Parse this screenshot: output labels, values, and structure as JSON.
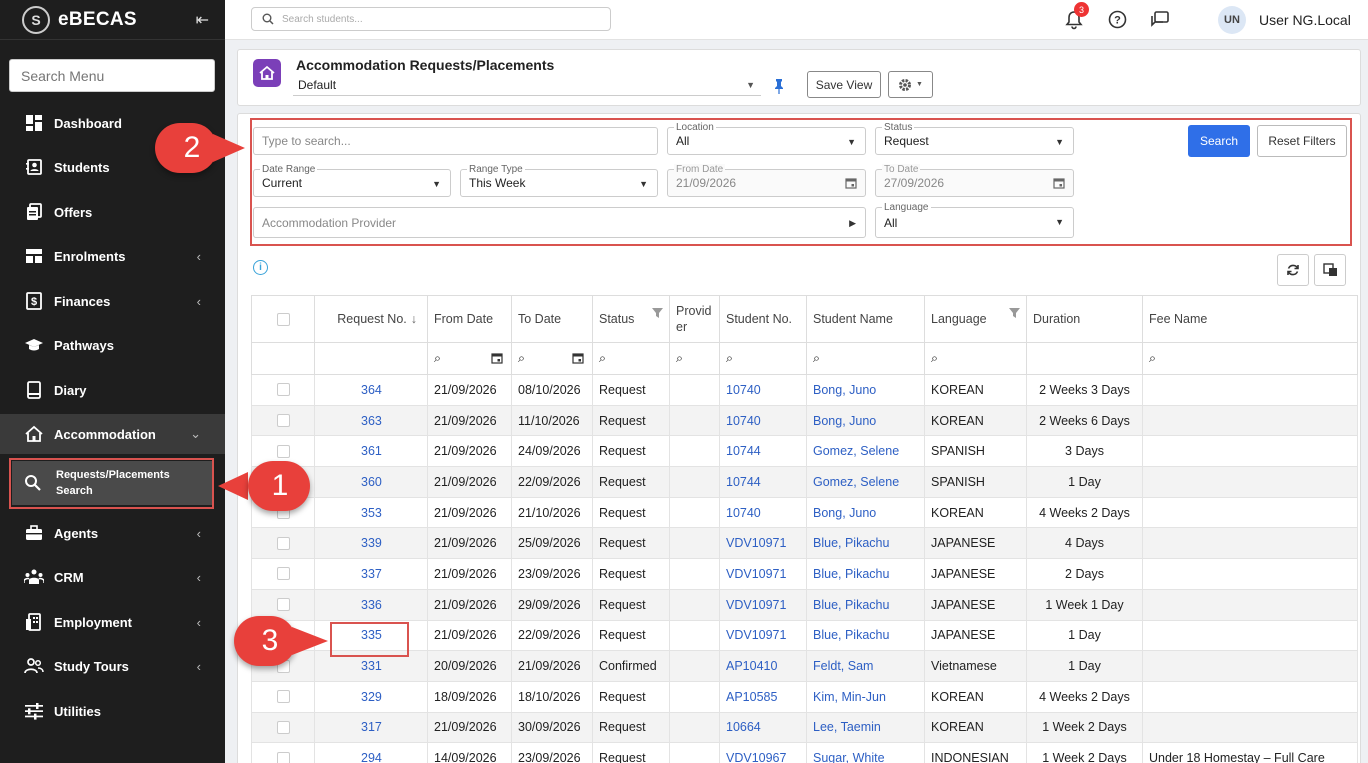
{
  "app": {
    "name": "eBECAS"
  },
  "sidebar": {
    "search_placeholder": "Search Menu",
    "items": [
      {
        "label": "Dashboard",
        "icon": "dashboard-icon",
        "chevron": ""
      },
      {
        "label": "Students",
        "icon": "students-icon",
        "chevron": ""
      },
      {
        "label": "Offers",
        "icon": "offers-icon",
        "chevron": ""
      },
      {
        "label": "Enrolments",
        "icon": "enrolments-icon",
        "chevron": "‹"
      },
      {
        "label": "Finances",
        "icon": "finances-icon",
        "chevron": "‹"
      },
      {
        "label": "Pathways",
        "icon": "pathways-icon",
        "chevron": ""
      },
      {
        "label": "Diary",
        "icon": "diary-icon",
        "chevron": ""
      },
      {
        "label": "Accommodation",
        "icon": "home-icon",
        "chevron": "⌄"
      },
      {
        "label": "Agents",
        "icon": "agents-icon",
        "chevron": "‹"
      },
      {
        "label": "CRM",
        "icon": "crm-icon",
        "chevron": "‹"
      },
      {
        "label": "Employment",
        "icon": "employment-icon",
        "chevron": "‹"
      },
      {
        "label": "Study Tours",
        "icon": "study-tours-icon",
        "chevron": "‹"
      },
      {
        "label": "Utilities",
        "icon": "utilities-icon",
        "chevron": ""
      }
    ],
    "subitem": {
      "label": "Requests/Placements Search"
    }
  },
  "topbar": {
    "search_placeholder": "Search students...",
    "notification_count": "3",
    "avatar_initials": "UN",
    "user_name": "User NG.Local"
  },
  "page": {
    "title": "Accommodation Requests/Placements",
    "view": "Default",
    "save_view": "Save View"
  },
  "filters": {
    "search_placeholder": "Type to search...",
    "location": {
      "label": "Location",
      "value": "All"
    },
    "status": {
      "label": "Status",
      "value": "Request"
    },
    "date_range": {
      "label": "Date Range",
      "value": "Current"
    },
    "range_type": {
      "label": "Range Type",
      "value": "This Week"
    },
    "from_date": {
      "label": "From Date",
      "value": "21/09/2026"
    },
    "to_date": {
      "label": "To Date",
      "value": "27/09/2026"
    },
    "provider_placeholder": "Accommodation Provider",
    "language": {
      "label": "Language",
      "value": "All"
    },
    "search_button": "Search",
    "reset_button": "Reset Filters"
  },
  "callouts": [
    "1",
    "2",
    "3"
  ],
  "table": {
    "columns": [
      "Request No.",
      "From Date",
      "To Date",
      "Status",
      "Provider",
      "Student No.",
      "Student Name",
      "Language",
      "Duration",
      "Fee Name"
    ],
    "rows": [
      {
        "req": "364",
        "from": "21/09/2026",
        "to": "08/10/2026",
        "status": "Request",
        "provider": "",
        "student_no": "10740",
        "student_name": "Bong, Juno",
        "language": "KOREAN",
        "duration": "2 Weeks 3 Days",
        "fee": ""
      },
      {
        "req": "363",
        "from": "21/09/2026",
        "to": "11/10/2026",
        "status": "Request",
        "provider": "",
        "student_no": "10740",
        "student_name": "Bong, Juno",
        "language": "KOREAN",
        "duration": "2 Weeks 6 Days",
        "fee": ""
      },
      {
        "req": "361",
        "from": "21/09/2026",
        "to": "24/09/2026",
        "status": "Request",
        "provider": "",
        "student_no": "10744",
        "student_name": "Gomez, Selene",
        "language": "SPANISH",
        "duration": "3 Days",
        "fee": ""
      },
      {
        "req": "360",
        "from": "21/09/2026",
        "to": "22/09/2026",
        "status": "Request",
        "provider": "",
        "student_no": "10744",
        "student_name": "Gomez, Selene",
        "language": "SPANISH",
        "duration": "1 Day",
        "fee": ""
      },
      {
        "req": "353",
        "from": "21/09/2026",
        "to": "21/10/2026",
        "status": "Request",
        "provider": "",
        "student_no": "10740",
        "student_name": "Bong, Juno",
        "language": "KOREAN",
        "duration": "4 Weeks 2 Days",
        "fee": ""
      },
      {
        "req": "339",
        "from": "21/09/2026",
        "to": "25/09/2026",
        "status": "Request",
        "provider": "",
        "student_no": "VDV10971",
        "student_name": "Blue, Pikachu",
        "language": "JAPANESE",
        "duration": "4 Days",
        "fee": ""
      },
      {
        "req": "337",
        "from": "21/09/2026",
        "to": "23/09/2026",
        "status": "Request",
        "provider": "",
        "student_no": "VDV10971",
        "student_name": "Blue, Pikachu",
        "language": "JAPANESE",
        "duration": "2 Days",
        "fee": ""
      },
      {
        "req": "336",
        "from": "21/09/2026",
        "to": "29/09/2026",
        "status": "Request",
        "provider": "",
        "student_no": "VDV10971",
        "student_name": "Blue, Pikachu",
        "language": "JAPANESE",
        "duration": "1 Week 1 Day",
        "fee": ""
      },
      {
        "req": "335",
        "from": "21/09/2026",
        "to": "22/09/2026",
        "status": "Request",
        "provider": "",
        "student_no": "VDV10971",
        "student_name": "Blue, Pikachu",
        "language": "JAPANESE",
        "duration": "1 Day",
        "fee": ""
      },
      {
        "req": "331",
        "from": "20/09/2026",
        "to": "21/09/2026",
        "status": "Confirmed",
        "provider": "",
        "student_no": "AP10410",
        "student_name": "Feldt, Sam",
        "language": "Vietnamese",
        "duration": "1 Day",
        "fee": ""
      },
      {
        "req": "329",
        "from": "18/09/2026",
        "to": "18/10/2026",
        "status": "Request",
        "provider": "",
        "student_no": "AP10585",
        "student_name": "Kim, Min-Jun",
        "language": "KOREAN",
        "duration": "4 Weeks 2 Days",
        "fee": ""
      },
      {
        "req": "317",
        "from": "21/09/2026",
        "to": "30/09/2026",
        "status": "Request",
        "provider": "",
        "student_no": "10664",
        "student_name": "Lee, Taemin",
        "language": "KOREAN",
        "duration": "1 Week 2 Days",
        "fee": ""
      },
      {
        "req": "294",
        "from": "14/09/2026",
        "to": "23/09/2026",
        "status": "Request",
        "provider": "",
        "student_no": "VDV10967",
        "student_name": "Sugar, White",
        "language": "INDONESIAN",
        "duration": "1 Week 2 Days",
        "fee": "Under 18 Homestay – Full Care"
      }
    ]
  }
}
